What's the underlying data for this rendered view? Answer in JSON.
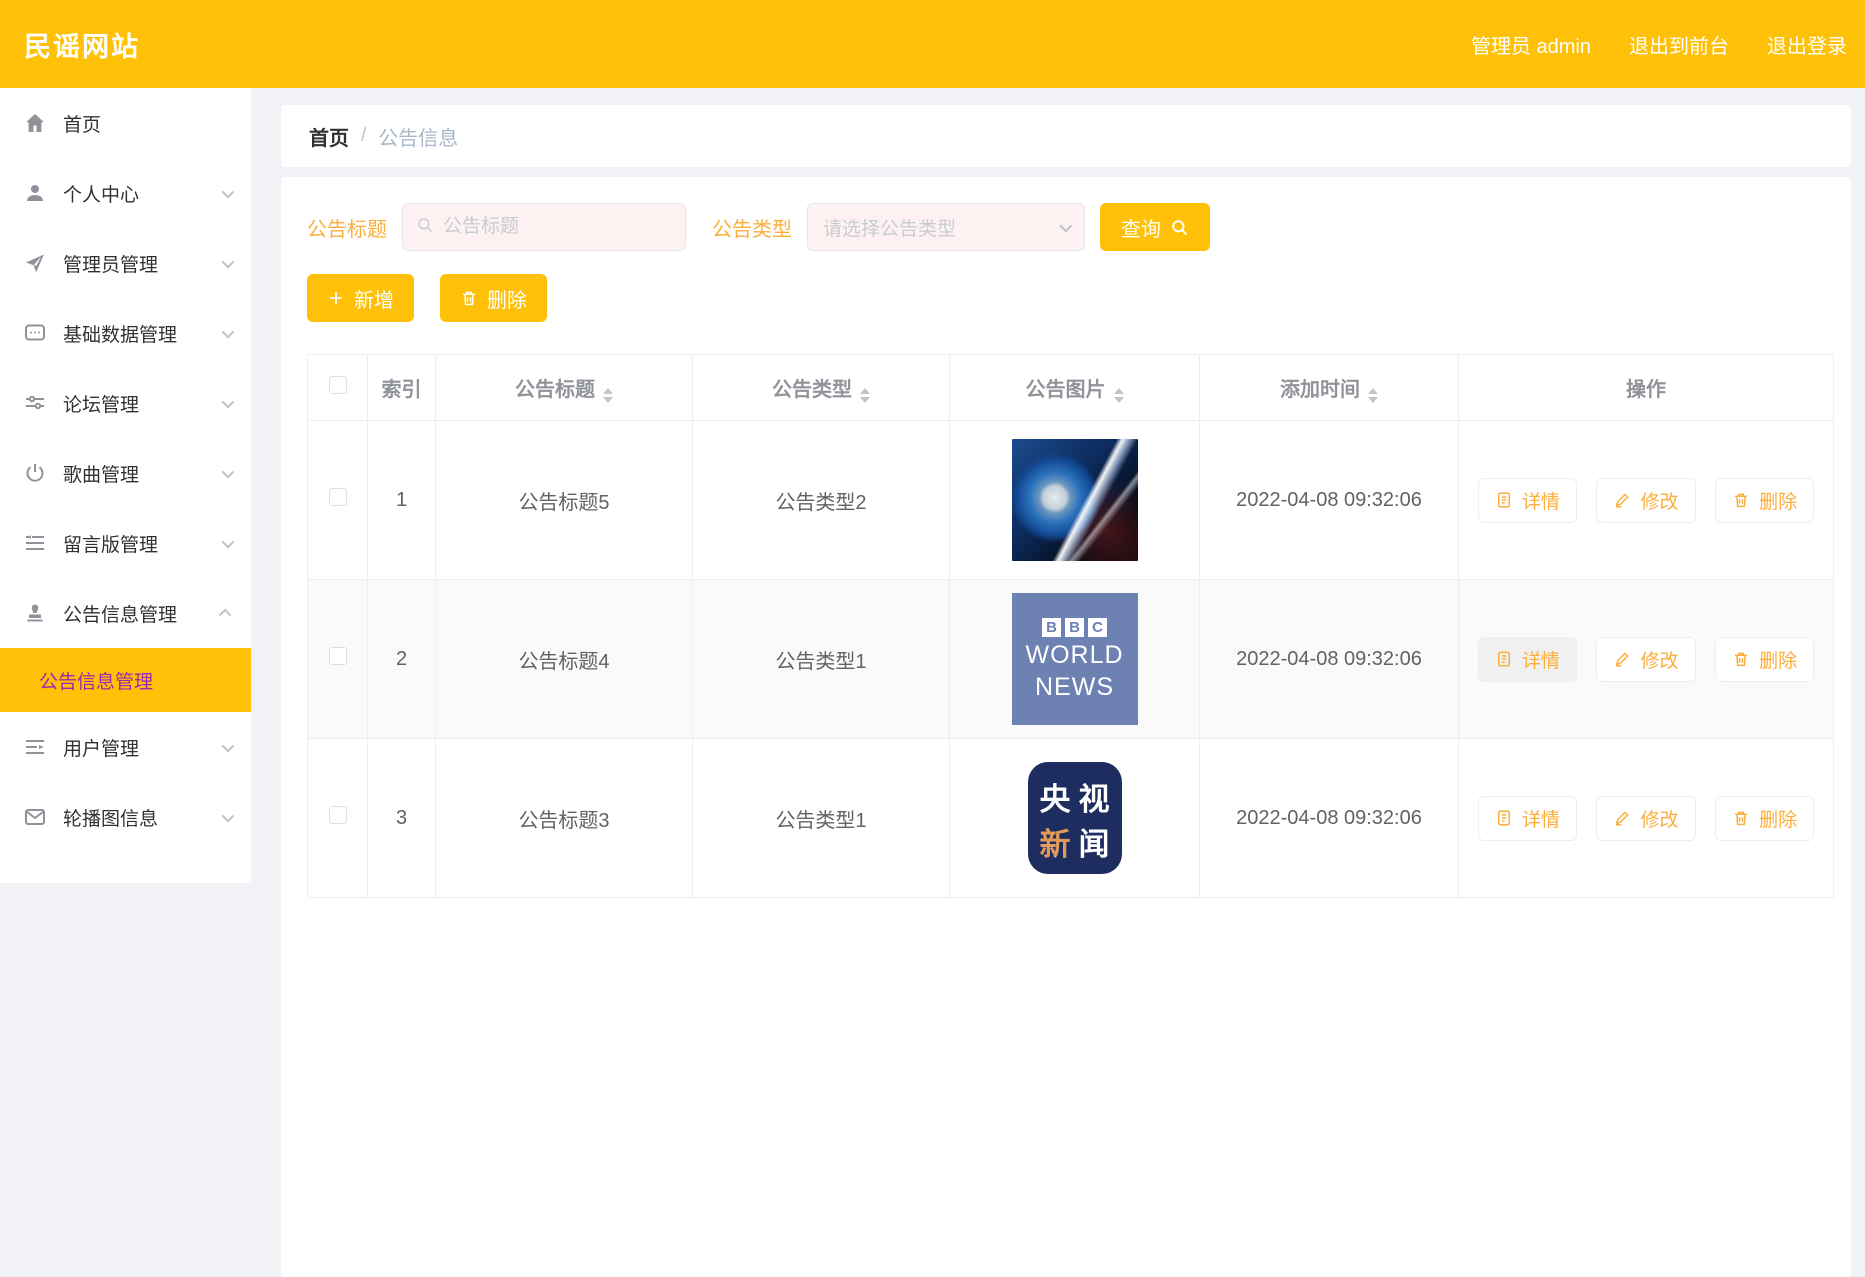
{
  "header": {
    "title": "民谣网站",
    "user": "管理员 admin",
    "link_front": "退出到前台",
    "link_logout": "退出登录"
  },
  "sidebar": {
    "items": [
      {
        "label": "首页",
        "icon": "home-icon"
      },
      {
        "label": "个人中心",
        "icon": "user-icon"
      },
      {
        "label": "管理员管理",
        "icon": "send-icon"
      },
      {
        "label": "基础数据管理",
        "icon": "comment-icon"
      },
      {
        "label": "论坛管理",
        "icon": "sliders-icon"
      },
      {
        "label": "歌曲管理",
        "icon": "power-icon"
      },
      {
        "label": "留言版管理",
        "icon": "list-indent-icon"
      },
      {
        "label": "公告信息管理",
        "icon": "stamp-icon"
      },
      {
        "label": "用户管理",
        "icon": "list-arrow-icon"
      },
      {
        "label": "轮播图信息",
        "icon": "mail-icon"
      }
    ],
    "active_submenu": "公告信息管理"
  },
  "breadcrumb": {
    "home": "首页",
    "separator": "/",
    "current": "公告信息"
  },
  "filters": {
    "title_label": "公告标题",
    "title_placeholder": "公告标题",
    "type_label": "公告类型",
    "type_placeholder": "请选择公告类型",
    "query_label": "查询"
  },
  "toolbar": {
    "add_label": "新增",
    "delete_label": "删除"
  },
  "table": {
    "headers": {
      "index": "索引",
      "title": "公告标题",
      "type": "公告类型",
      "image": "公告图片",
      "time": "添加时间",
      "ops": "操作"
    },
    "action_labels": {
      "detail": "详情",
      "edit": "修改",
      "delete": "删除"
    },
    "rows": [
      {
        "index": "1",
        "title": "公告标题5",
        "type": "公告类型2",
        "image": "globe-news",
        "time": "2022-04-08 09:32:06"
      },
      {
        "index": "2",
        "title": "公告标题4",
        "type": "公告类型1",
        "image": "bbc-world-news",
        "time": "2022-04-08 09:32:06",
        "bbc": {
          "b1": "B",
          "b2": "B",
          "b3": "C",
          "word1": "WORLD",
          "word2": "NEWS"
        }
      },
      {
        "index": "3",
        "title": "公告标题3",
        "type": "公告类型1",
        "image": "cctv-news",
        "time": "2022-04-08 09:32:06",
        "cctv": {
          "c1": "央",
          "c2": "视",
          "c3": "新",
          "c4": "闻"
        }
      }
    ]
  },
  "colors": {
    "accent_yellow": "#ffc107",
    "active_text_purple": "#9c27b0",
    "orange_text": "#fcae3c",
    "table_header_text": "#909399",
    "page_background": "#f0f2f5"
  }
}
